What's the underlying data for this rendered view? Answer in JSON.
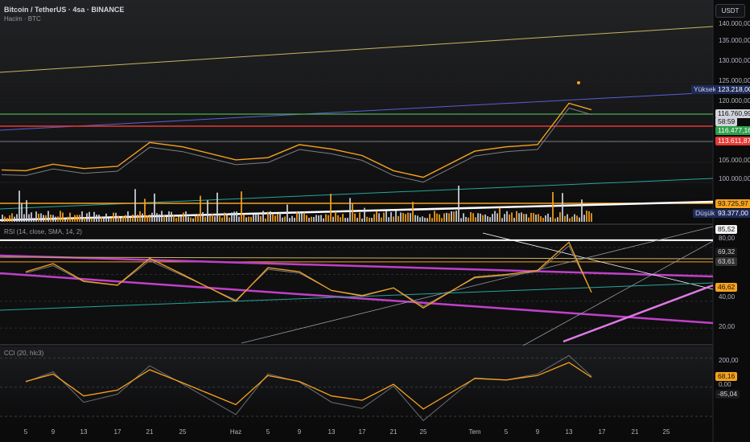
{
  "header": {
    "title": "Bitcoin / TetherUS · 4sa · BINANCE",
    "volume_label": "Hacim · BTC",
    "rsi_label": "RSI (14, close, SMA, 14, 2)",
    "cci_label": "CCI (20, hlc3)",
    "currency_button": "USDT"
  },
  "colors": {
    "price_line": "#f7a21d",
    "sma_line": "#7b7f87",
    "volume_orange": "#f7a21d",
    "volume_white": "#d1d4dc",
    "support_orange": "#f7a21d",
    "resistance_red": "#e53935",
    "green_line": "#4caf50",
    "blue_line": "#5b5fd6",
    "teal_line": "#26a69a",
    "yellow_line": "#c8b560",
    "magenta_line": "#c040c8"
  },
  "price_axis": {
    "ticks": [
      "140.000,00",
      "135.000,00",
      "130.000,00",
      "125.000,00",
      "120.000,00",
      "105.000,00",
      "100.000,00"
    ],
    "labels": {
      "high_word": "Yüksek",
      "high_value": "123.218,00",
      "last_price": "116.760,99",
      "countdown": "58:59",
      "green_level": "116.477,16",
      "red_level": "113.611,87",
      "orange_level": "93.725,97",
      "low_word": "Düşük",
      "low_value": "93.377,00"
    }
  },
  "rsi_axis": {
    "ticks": [
      "80,00",
      "40,00",
      "20,00"
    ],
    "labels": {
      "white_level": "85,52",
      "level_a": "69,32",
      "level_b": "63,61",
      "orange_value": "46,62"
    }
  },
  "cci_axis": {
    "ticks": [
      "200,00",
      "0,00"
    ],
    "labels": {
      "value_a": "68,16",
      "value_b": "-85,04"
    }
  },
  "x_axis": {
    "ticks": [
      "5",
      "9",
      "13",
      "17",
      "21",
      "25",
      "Haz",
      "5",
      "9",
      "13",
      "17",
      "21",
      "25",
      "Tem",
      "5",
      "9",
      "13",
      "17",
      "21",
      "25"
    ]
  },
  "chart_data": [
    {
      "type": "line",
      "title": "Bitcoin / TetherUS · 4sa · BINANCE",
      "x": [
        "5",
        "9",
        "13",
        "17",
        "21",
        "25",
        "Haz",
        "5",
        "9",
        "13",
        "17",
        "21",
        "25",
        "Tem",
        "5",
        "9",
        "13",
        "17"
      ],
      "series": [
        {
          "values": [
            103000,
            104500,
            103500,
            104000,
            109500,
            108500,
            105500,
            106000,
            109000,
            108000,
            106500,
            103000,
            101500,
            107500,
            108500,
            109000,
            118500,
            117000
          ]
        }
      ],
      "ylim": [
        92000,
        141500
      ],
      "annotations": {
        "high": 123218,
        "low": 93377,
        "last": 116760.99
      }
    },
    {
      "type": "line",
      "title": "RSI (14, close, SMA, 14, 2)",
      "x": [
        "5",
        "9",
        "13",
        "17",
        "21",
        "25",
        "Haz",
        "5",
        "9",
        "13",
        "17",
        "21",
        "25",
        "Tem",
        "5",
        "9",
        "13",
        "17"
      ],
      "series": [
        {
          "values": [
            62,
            68,
            55,
            52,
            72,
            60,
            40,
            65,
            62,
            48,
            44,
            50,
            35,
            58,
            60,
            63,
            84,
            46.62
          ]
        }
      ],
      "ylim": [
        10,
        95
      ],
      "annotations": {
        "levels": [
          85.52,
          69.32,
          63.61,
          46.62
        ]
      }
    },
    {
      "type": "line",
      "title": "CCI (20, hlc3)",
      "x": [
        "5",
        "9",
        "13",
        "17",
        "21",
        "25",
        "Haz",
        "5",
        "9",
        "13",
        "17",
        "21",
        "25",
        "Tem",
        "5",
        "9",
        "13",
        "17"
      ],
      "series": [
        {
          "values": [
            40,
            90,
            -60,
            -20,
            120,
            30,
            -120,
            80,
            40,
            -60,
            -90,
            20,
            -150,
            60,
            50,
            80,
            170,
            68.16
          ]
        }
      ],
      "ylim": [
        -250,
        270
      ],
      "annotations": {
        "values": [
          68.16,
          -85.04
        ]
      }
    }
  ]
}
